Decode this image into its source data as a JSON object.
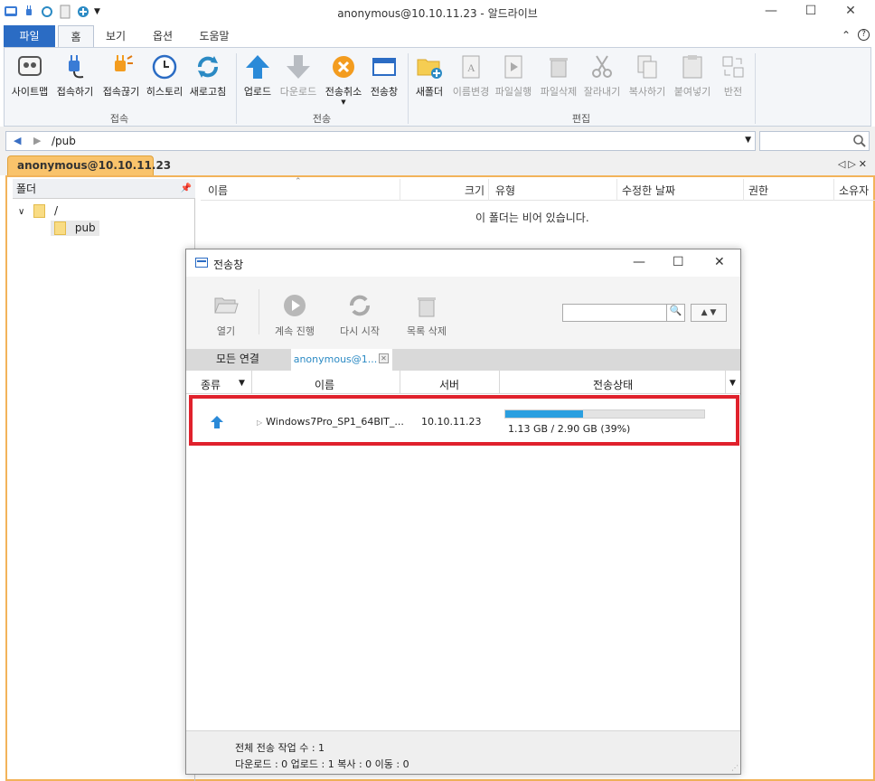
{
  "window": {
    "title": "anonymous@10.10.11.23 - 알드라이브",
    "min": "—",
    "max": "☐",
    "close": "✕"
  },
  "tabs": {
    "file": "파일",
    "items": [
      "홈",
      "보기",
      "옵션",
      "도움말"
    ]
  },
  "ribbon": {
    "groups": {
      "connect": "접속",
      "transfer": "전송",
      "edit": "편집"
    },
    "buttons": {
      "sitemap": "사이트맵",
      "connect": "접속하기",
      "disconnect": "접속끊기",
      "history": "히스토리",
      "refresh": "새로고침",
      "upload": "업로드",
      "download": "다운로드",
      "cancel_transfer": "전송취소",
      "transfer_window": "전송창",
      "new_folder": "새폴더",
      "rename": "이름변경",
      "run_file": "파일실행",
      "delete_file": "파일삭제",
      "cut": "잘라내기",
      "copy": "복사하기",
      "paste": "붙여넣기",
      "invert": "반전"
    }
  },
  "address": {
    "path": "/pub"
  },
  "session": {
    "tab_label": "anonymous@10.10.11.23"
  },
  "folder_pane": {
    "header": "폴더",
    "root": "/",
    "child": "pub"
  },
  "file_pane": {
    "columns": [
      "이름",
      "크기",
      "유형",
      "수정한 날짜",
      "권한",
      "소유자"
    ],
    "empty_message": "이 폴더는 비어 있습니다."
  },
  "transfer_window": {
    "title": "전송창",
    "toolbar": {
      "open": "열기",
      "resume": "계속 진행",
      "restart": "다시 시작",
      "clear_list": "목록 삭제"
    },
    "tabs": [
      "모든 연결",
      "anonymous@1..."
    ],
    "columns": {
      "type": "종류",
      "name": "이름",
      "server": "서버",
      "status": "전송상태"
    },
    "rows": [
      {
        "direction": "upload",
        "name": "Windows7Pro_SP1_64BIT_...",
        "server": "10.10.11.23",
        "progress": 0.39,
        "status_text": "1.13 GB / 2.90 GB (39%)"
      }
    ],
    "footer": {
      "total": "전체 전송 작업 수 : 1",
      "breakdown": "다운로드 : 0  업로드 : 1  복사 : 0  이동 : 0"
    }
  },
  "colors": {
    "accent": "#2b6cc4",
    "session_tab": "#f9c36b",
    "highlight": "#e0212c",
    "progress": "#2a9fe0"
  }
}
